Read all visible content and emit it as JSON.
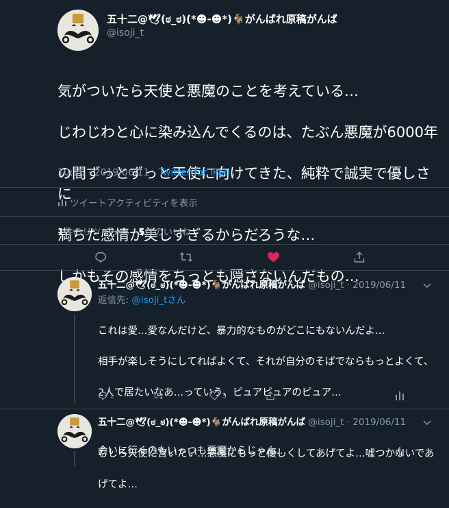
{
  "main_tweet": {
    "display_name": "五十二@🕊(ಠ_ಠ)(*☻-☻*)🐐がんばれ原稿がんば",
    "handle": "@isoji_t",
    "text_lines": [
      "気がついたら天使と悪魔のことを考えている…",
      "じわじわと心に染み込んでくるのは、たぶん悪魔が6000年",
      "の間ずっとずっと天使に向けてきた、純粋で誠実で優しさに",
      "満ちた感情が美しすぎるからだろうな…",
      "しかもその感情をちっとも隠さないんだもの…"
    ],
    "time": "10:18 · 2019/06/11 · ",
    "source": "Twitter for iPad",
    "activity_label": "ツイートアクティビティを表示",
    "retweets_count": "1",
    "retweets_label": "件のリツイート",
    "likes_count": "5",
    "likes_label": "件のいいね",
    "liked_color": "#e0245e"
  },
  "replies": [
    {
      "display_name": "五十二@🕊(ಠ_ಠ)(*☻-☻*)🐐がんばれ原稿がんば",
      "handle_date": "@isoji_t · 2019/06/11",
      "reply_prefix": "返信先: ",
      "reply_to": "@isoji_tさん",
      "text_lines": [
        "これは愛…愛なんだけど、暴力的なものがどこにもないんだよ…",
        "相手が楽しそうにしてればよくて、それが自分のそばでならもっとよくて、",
        "2人で居たいなあ…っていう、ピュアピュアのピュア…",
        "",
        "むしろ天使に言いたい…悪魔にもっと優しくしてあげてよ…嘘つかないであ",
        "げてよ…"
      ],
      "reply_count": "1",
      "retweet_count": "",
      "like_count": "3"
    },
    {
      "display_name": "五十二@🕊(ಠ_ಠ)(*☻-☻*)🐐がんばれ原稿がんば",
      "handle_date": "@isoji_t · 2019/06/11",
      "text_lines": [
        "会いに行くのもいっつも悪魔からじゃん…"
      ],
      "reply_count": "",
      "retweet_count": "",
      "like_count": "3"
    }
  ]
}
